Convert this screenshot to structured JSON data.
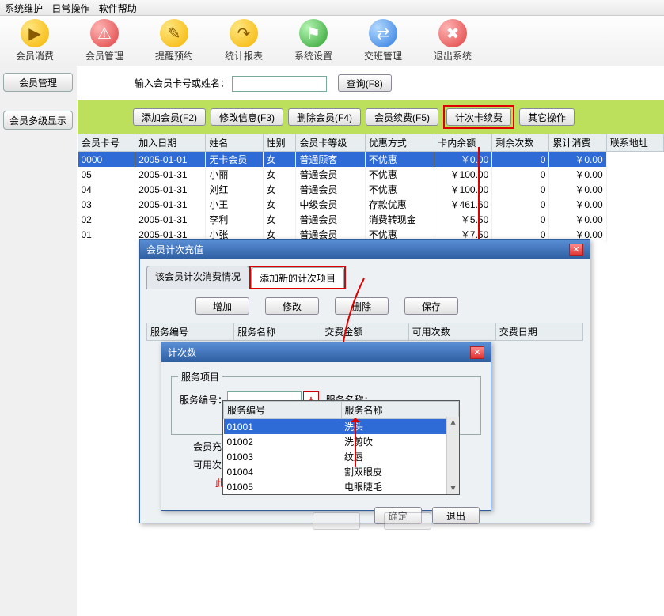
{
  "menu": {
    "m1": "系统维护",
    "m2": "日常操作",
    "m3": "软件帮助"
  },
  "toolbar": [
    {
      "label": "会员消费",
      "cls": "tool-yellow",
      "glyph": "▶"
    },
    {
      "label": "会员管理",
      "cls": "tool-red",
      "glyph": "⚠"
    },
    {
      "label": "提醒预约",
      "cls": "tool-yellow",
      "glyph": "✎"
    },
    {
      "label": "统计报表",
      "cls": "tool-yellow",
      "glyph": "↷"
    },
    {
      "label": "系统设置",
      "cls": "tool-green",
      "glyph": "⚑"
    },
    {
      "label": "交班管理",
      "cls": "tool-blue",
      "glyph": "⇄"
    },
    {
      "label": "退出系统",
      "cls": "tool-red",
      "glyph": "✖"
    }
  ],
  "side": {
    "b1": "会员管理",
    "b2": "会员多级显示"
  },
  "search": {
    "label": "输入会员卡号或姓名：",
    "btn": "查询(F8)"
  },
  "actions": {
    "a1": "添加会员(F2)",
    "a2": "修改信息(F3)",
    "a3": "删除会员(F4)",
    "a4": "会员续费(F5)",
    "a5": "计次卡续费",
    "a6": "其它操作"
  },
  "grid_headers": [
    "会员卡号",
    "加入日期",
    "姓名",
    "性别",
    "会员卡等级",
    "优惠方式",
    "卡内余额",
    "剩余次数",
    "累计消费",
    "联系地址"
  ],
  "grid_rows": [
    {
      "c0": "0000",
      "c1": "2005-01-01",
      "c2": "无卡会员",
      "c3": "女",
      "c4": "普通顾客",
      "c5": "不优惠",
      "c6": "￥0.00",
      "c7": "0",
      "c8": "￥0.00",
      "sel": true
    },
    {
      "c0": "05",
      "c1": "2005-01-31",
      "c2": "小丽",
      "c3": "女",
      "c4": "普通会员",
      "c5": "不优惠",
      "c6": "￥100.00",
      "c7": "0",
      "c8": "￥0.00"
    },
    {
      "c0": "04",
      "c1": "2005-01-31",
      "c2": "刘红",
      "c3": "女",
      "c4": "普通会员",
      "c5": "不优惠",
      "c6": "￥100.00",
      "c7": "0",
      "c8": "￥0.00"
    },
    {
      "c0": "03",
      "c1": "2005-01-31",
      "c2": "小王",
      "c3": "女",
      "c4": "中级会员",
      "c5": "存款优惠",
      "c6": "￥461.60",
      "c7": "0",
      "c8": "￥0.00"
    },
    {
      "c0": "02",
      "c1": "2005-01-31",
      "c2": "李利",
      "c3": "女",
      "c4": "普通会员",
      "c5": "消费转现金",
      "c6": "￥5.50",
      "c7": "0",
      "c8": "￥0.00"
    },
    {
      "c0": "01",
      "c1": "2005-01-31",
      "c2": "小张",
      "c3": "女",
      "c4": "普通会员",
      "c5": "不优惠",
      "c6": "￥7.50",
      "c7": "0",
      "c8": "￥0.00"
    }
  ],
  "dlg1": {
    "title": "会员计次充值",
    "tab1": "该会员计次消费情况",
    "tab2": "添加新的计次项目",
    "b_add": "增加",
    "b_mod": "修改",
    "b_del": "删除",
    "b_save": "保存",
    "h": [
      "服务编号",
      "服务名称",
      "交费金额",
      "可用次数",
      "交费日期"
    ]
  },
  "dlg2": {
    "title": "计次数",
    "legend": "服务项目",
    "l_code": "服务编号：",
    "l_name": "服务名称：",
    "l_charge": "会员充值情",
    "l_times": "可用次数",
    "note": "此",
    "ok": "确定",
    "cancel": "退出"
  },
  "dropdown": {
    "h1": "服务编号",
    "h2": "服务名称",
    "rows": [
      {
        "code": "01001",
        "name": "洗头",
        "sel": true
      },
      {
        "code": "01002",
        "name": "洗剪吹"
      },
      {
        "code": "01003",
        "name": "纹唇"
      },
      {
        "code": "01004",
        "name": "割双眼皮"
      },
      {
        "code": "01005",
        "name": "电眼睫毛"
      }
    ]
  }
}
